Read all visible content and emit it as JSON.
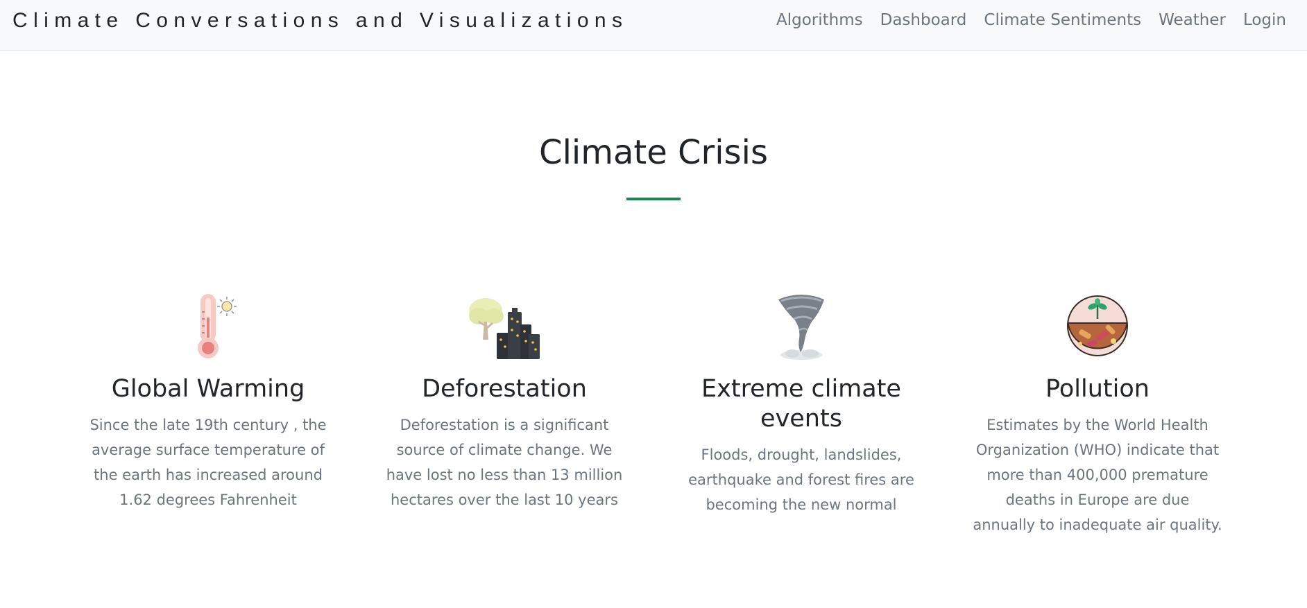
{
  "navbar": {
    "brand": "Climate Conversations and Visualizations",
    "links": [
      {
        "label": "Algorithms"
      },
      {
        "label": "Dashboard"
      },
      {
        "label": "Climate Sentiments"
      },
      {
        "label": "Weather"
      },
      {
        "label": "Login"
      }
    ]
  },
  "section": {
    "title": "Climate Crisis",
    "accent_color": "#198754"
  },
  "features": [
    {
      "icon": "thermometer-icon",
      "title": "Global Warming",
      "text": "Since the late 19th century , the average surface temperature of the earth has increased around 1.62 degrees Fahrenheit"
    },
    {
      "icon": "tree-city-icon",
      "title": "Deforestation",
      "text": "Deforestation is a significant source of climate change. We have lost no less than 13 million hectares over the last 10 years"
    },
    {
      "icon": "tornado-icon",
      "title": "Extreme climate events",
      "text": "Floods, drought, landslides, earthquake and forest fires are becoming the new normal"
    },
    {
      "icon": "polluted-soil-icon",
      "title": "Pollution",
      "text": "Estimates by the World Health Organization (WHO) indicate that more than 400,000 premature deaths in Europe are due annually to inadequate air quality."
    }
  ]
}
